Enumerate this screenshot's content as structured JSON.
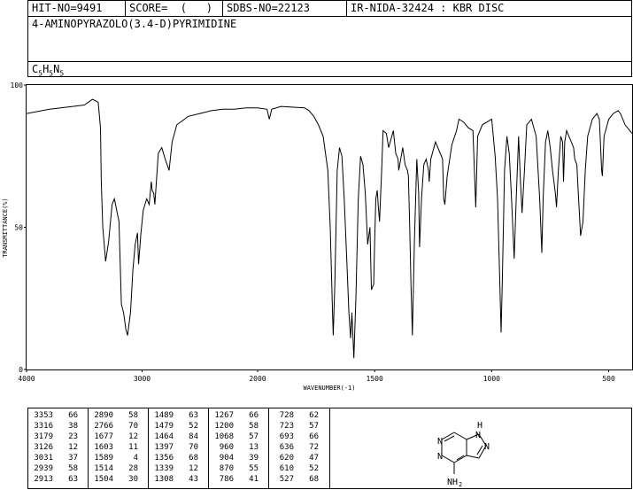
{
  "header": {
    "hit_no": "HIT-NO=9491",
    "score": "SCORE=  (   )",
    "sdbs_no": "SDBS-NO=22123",
    "ir_info": "IR-NIDA-32424 : KBR DISC"
  },
  "compound_name": "4-AMINOPYRAZOLO(3.4-D)PYRIMIDINE",
  "formula": {
    "c": "C",
    "c_n": "5",
    "h": "H",
    "h_n": "5",
    "n": "N",
    "n_n": "5"
  },
  "chart_data": {
    "type": "line",
    "xlabel": "WAVENUMBER(-1)",
    "ylabel": "TRANSMITTANCE(%)",
    "xlim": [
      4000,
      400
    ],
    "ylim": [
      0,
      100
    ],
    "x_ticks": [
      4000,
      3000,
      2000,
      1500,
      1000,
      500
    ],
    "y_ticks": [
      0,
      50,
      100
    ],
    "series": [
      {
        "points": [
          [
            4000,
            90
          ],
          [
            3800,
            91.5
          ],
          [
            3600,
            92.5
          ],
          [
            3500,
            93
          ],
          [
            3430,
            95
          ],
          [
            3380,
            94
          ],
          [
            3360,
            85
          ],
          [
            3353,
            66
          ],
          [
            3340,
            50
          ],
          [
            3316,
            38
          ],
          [
            3290,
            45
          ],
          [
            3260,
            58
          ],
          [
            3240,
            60
          ],
          [
            3200,
            52
          ],
          [
            3179,
            23
          ],
          [
            3160,
            20
          ],
          [
            3140,
            14
          ],
          [
            3126,
            12
          ],
          [
            3100,
            20
          ],
          [
            3080,
            35
          ],
          [
            3060,
            44
          ],
          [
            3040,
            48
          ],
          [
            3031,
            37
          ],
          [
            3010,
            48
          ],
          [
            2990,
            56
          ],
          [
            2960,
            60
          ],
          [
            2939,
            58
          ],
          [
            2920,
            66
          ],
          [
            2913,
            63
          ],
          [
            2900,
            62
          ],
          [
            2890,
            58
          ],
          [
            2860,
            76
          ],
          [
            2830,
            78
          ],
          [
            2800,
            74
          ],
          [
            2766,
            70
          ],
          [
            2740,
            80
          ],
          [
            2700,
            86
          ],
          [
            2600,
            89
          ],
          [
            2500,
            90
          ],
          [
            2400,
            91
          ],
          [
            2300,
            91.5
          ],
          [
            2200,
            91.5
          ],
          [
            2100,
            92
          ],
          [
            2000,
            92
          ],
          [
            1960,
            91.5
          ],
          [
            1950,
            88
          ],
          [
            1940,
            91.5
          ],
          [
            1900,
            92.5
          ],
          [
            1800,
            92
          ],
          [
            1780,
            91
          ],
          [
            1760,
            89
          ],
          [
            1740,
            86
          ],
          [
            1720,
            82
          ],
          [
            1700,
            70
          ],
          [
            1690,
            50
          ],
          [
            1680,
            20
          ],
          [
            1677,
            12
          ],
          [
            1670,
            30
          ],
          [
            1660,
            70
          ],
          [
            1650,
            78
          ],
          [
            1640,
            75
          ],
          [
            1630,
            60
          ],
          [
            1620,
            40
          ],
          [
            1610,
            20
          ],
          [
            1603,
            11
          ],
          [
            1597,
            20
          ],
          [
            1589,
            4
          ],
          [
            1580,
            25
          ],
          [
            1570,
            60
          ],
          [
            1560,
            75
          ],
          [
            1550,
            72
          ],
          [
            1540,
            62
          ],
          [
            1530,
            44
          ],
          [
            1520,
            50
          ],
          [
            1514,
            28
          ],
          [
            1504,
            30
          ],
          [
            1500,
            45
          ],
          [
            1495,
            60
          ],
          [
            1489,
            63
          ],
          [
            1484,
            57
          ],
          [
            1479,
            52
          ],
          [
            1470,
            70
          ],
          [
            1464,
            84
          ],
          [
            1450,
            83
          ],
          [
            1440,
            78
          ],
          [
            1420,
            84
          ],
          [
            1410,
            76
          ],
          [
            1400,
            74
          ],
          [
            1397,
            70
          ],
          [
            1380,
            78
          ],
          [
            1370,
            72
          ],
          [
            1360,
            70
          ],
          [
            1356,
            68
          ],
          [
            1350,
            50
          ],
          [
            1345,
            30
          ],
          [
            1339,
            12
          ],
          [
            1330,
            45
          ],
          [
            1320,
            74
          ],
          [
            1312,
            62
          ],
          [
            1308,
            43
          ],
          [
            1300,
            60
          ],
          [
            1290,
            72
          ],
          [
            1280,
            74
          ],
          [
            1270,
            70
          ],
          [
            1267,
            66
          ],
          [
            1260,
            74
          ],
          [
            1240,
            80
          ],
          [
            1220,
            76
          ],
          [
            1210,
            74
          ],
          [
            1205,
            60
          ],
          [
            1200,
            58
          ],
          [
            1190,
            68
          ],
          [
            1170,
            79
          ],
          [
            1150,
            84
          ],
          [
            1140,
            88
          ],
          [
            1120,
            87
          ],
          [
            1100,
            85
          ],
          [
            1080,
            84
          ],
          [
            1068,
            57
          ],
          [
            1060,
            82
          ],
          [
            1040,
            86
          ],
          [
            1000,
            88
          ],
          [
            985,
            75
          ],
          [
            975,
            60
          ],
          [
            965,
            30
          ],
          [
            960,
            13
          ],
          [
            955,
            30
          ],
          [
            945,
            70
          ],
          [
            935,
            82
          ],
          [
            925,
            76
          ],
          [
            915,
            60
          ],
          [
            904,
            39
          ],
          [
            895,
            60
          ],
          [
            885,
            82
          ],
          [
            878,
            68
          ],
          [
            870,
            55
          ],
          [
            860,
            70
          ],
          [
            850,
            86
          ],
          [
            830,
            88
          ],
          [
            810,
            82
          ],
          [
            795,
            60
          ],
          [
            786,
            41
          ],
          [
            780,
            60
          ],
          [
            770,
            80
          ],
          [
            760,
            84
          ],
          [
            750,
            78
          ],
          [
            740,
            70
          ],
          [
            728,
            62
          ],
          [
            723,
            57
          ],
          [
            715,
            70
          ],
          [
            705,
            82
          ],
          [
            697,
            80
          ],
          [
            693,
            66
          ],
          [
            688,
            80
          ],
          [
            680,
            84
          ],
          [
            670,
            82
          ],
          [
            660,
            80
          ],
          [
            650,
            78
          ],
          [
            645,
            74
          ],
          [
            636,
            72
          ],
          [
            630,
            62
          ],
          [
            620,
            47
          ],
          [
            614,
            50
          ],
          [
            610,
            52
          ],
          [
            600,
            70
          ],
          [
            590,
            82
          ],
          [
            570,
            88
          ],
          [
            550,
            90
          ],
          [
            540,
            88
          ],
          [
            530,
            70
          ],
          [
            527,
            68
          ],
          [
            520,
            82
          ],
          [
            500,
            88
          ],
          [
            480,
            90
          ],
          [
            460,
            91
          ],
          [
            450,
            90
          ],
          [
            430,
            86
          ],
          [
            410,
            84
          ],
          [
            400,
            83
          ]
        ]
      }
    ]
  },
  "peaks": [
    [
      [
        "3353",
        "66"
      ],
      [
        "3316",
        "38"
      ],
      [
        "3179",
        "23"
      ],
      [
        "3126",
        "12"
      ],
      [
        "3031",
        "37"
      ],
      [
        "2939",
        "58"
      ],
      [
        "2913",
        "63"
      ]
    ],
    [
      [
        "2890",
        "58"
      ],
      [
        "2766",
        "70"
      ],
      [
        "1677",
        "12"
      ],
      [
        "1603",
        "11"
      ],
      [
        "1589",
        "4"
      ],
      [
        "1514",
        "28"
      ],
      [
        "1504",
        "30"
      ]
    ],
    [
      [
        "1489",
        "63"
      ],
      [
        "1479",
        "52"
      ],
      [
        "1464",
        "84"
      ],
      [
        "1397",
        "70"
      ],
      [
        "1356",
        "68"
      ],
      [
        "1339",
        "12"
      ],
      [
        "1308",
        "43"
      ]
    ],
    [
      [
        "1267",
        "66"
      ],
      [
        "1200",
        "58"
      ],
      [
        "1068",
        "57"
      ],
      [
        "960",
        "13"
      ],
      [
        "904",
        "39"
      ],
      [
        "870",
        "55"
      ],
      [
        "786",
        "41"
      ]
    ],
    [
      [
        "728",
        "62"
      ],
      [
        "723",
        "57"
      ],
      [
        "693",
        "66"
      ],
      [
        "636",
        "72"
      ],
      [
        "620",
        "47"
      ],
      [
        "610",
        "52"
      ],
      [
        "527",
        "68"
      ]
    ]
  ],
  "structure": {
    "nh_label": "H",
    "n_label": "N",
    "nh2_n": "NH",
    "nh2_sub": "2"
  }
}
